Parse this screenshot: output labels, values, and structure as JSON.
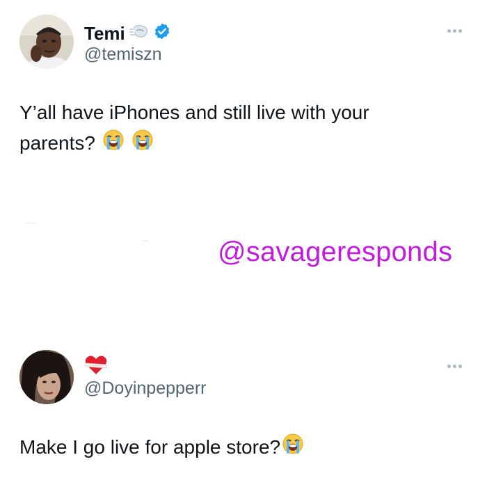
{
  "post1": {
    "display_name": "Temi",
    "name_emoji": "dashing-away-icon",
    "verified": true,
    "handle": "@temiszn",
    "text_line1": "Y’all have iPhones and still live with your",
    "text_line2": "parents?",
    "emojis": [
      "loudly-crying-face-icon",
      "loudly-crying-face-icon"
    ]
  },
  "watermark": {
    "text": "@savageresponds",
    "color": "#c41be0"
  },
  "post2": {
    "display_name_emoji": "mending-heart-icon",
    "handle": "@Doyinpepperr",
    "text": "Make I go live for apple store?",
    "emojis": [
      "loudly-crying-face-icon"
    ]
  },
  "colors": {
    "text": "#0f1419",
    "secondary": "#536471",
    "verified": "#1d9bf0"
  }
}
